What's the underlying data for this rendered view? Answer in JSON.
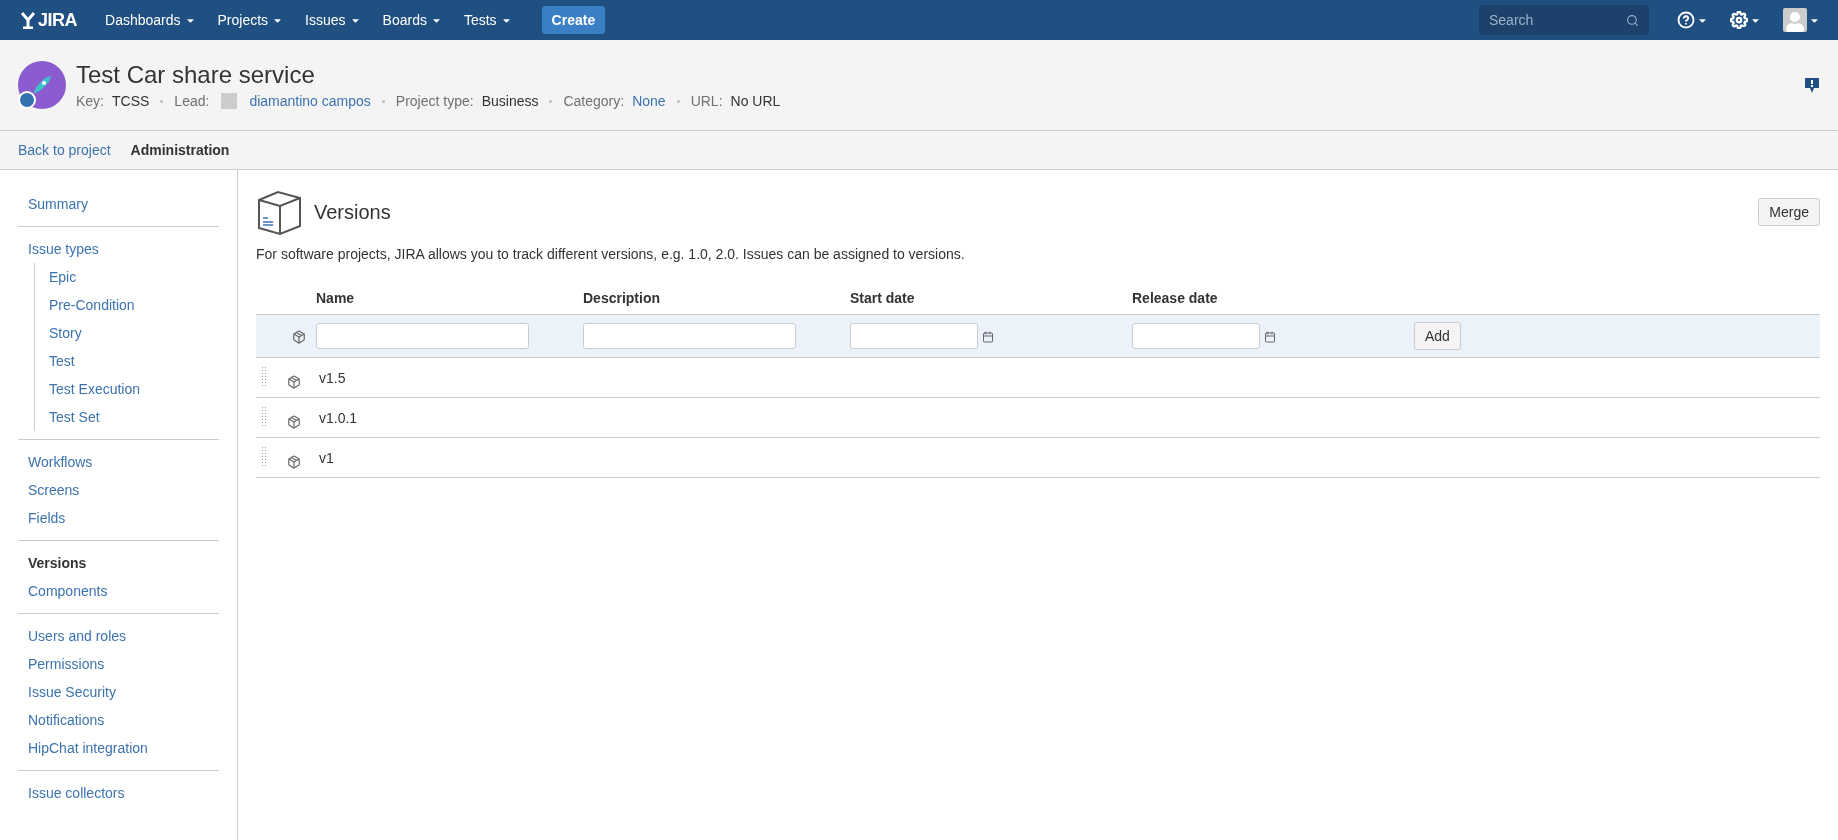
{
  "topnav": {
    "logo": "JIRA",
    "menus": [
      {
        "label": "Dashboards"
      },
      {
        "label": "Projects"
      },
      {
        "label": "Issues"
      },
      {
        "label": "Boards"
      },
      {
        "label": "Tests"
      }
    ],
    "create": "Create",
    "search": {
      "placeholder": "Search"
    }
  },
  "project": {
    "title": "Test Car share service",
    "meta": [
      {
        "kind": "plain",
        "label": "Key:",
        "value": "TCSS"
      },
      {
        "kind": "user",
        "label": "Lead:",
        "value": "diamantino campos"
      },
      {
        "kind": "plain",
        "label": "Project type:",
        "value": "Business"
      },
      {
        "kind": "link",
        "label": "Category:",
        "value": "None"
      },
      {
        "kind": "plain",
        "label": "URL:",
        "value": "No URL"
      }
    ]
  },
  "tabs": [
    {
      "label": "Back to project",
      "selected": false
    },
    {
      "label": "Administration",
      "selected": true
    }
  ],
  "sidebar": {
    "groups": [
      [
        {
          "label": "Summary",
          "selected": false
        }
      ],
      [
        {
          "label": "Issue types",
          "selected": false,
          "children": [
            {
              "label": "Epic",
              "selected": false
            },
            {
              "label": "Pre-Condition",
              "selected": false
            },
            {
              "label": "Story",
              "selected": false
            },
            {
              "label": "Test",
              "selected": false
            },
            {
              "label": "Test Execution",
              "selected": false
            },
            {
              "label": "Test Set",
              "selected": false
            }
          ]
        }
      ],
      [
        {
          "label": "Workflows",
          "selected": false
        },
        {
          "label": "Screens",
          "selected": false
        },
        {
          "label": "Fields",
          "selected": false
        }
      ],
      [
        {
          "label": "Versions",
          "selected": true
        },
        {
          "label": "Components",
          "selected": false
        }
      ],
      [
        {
          "label": "Users and roles",
          "selected": false
        },
        {
          "label": "Permissions",
          "selected": false
        },
        {
          "label": "Issue Security",
          "selected": false
        },
        {
          "label": "Notifications",
          "selected": false
        },
        {
          "label": "HipChat integration",
          "selected": false
        }
      ],
      [
        {
          "label": "Issue collectors",
          "selected": false
        }
      ]
    ]
  },
  "main": {
    "title": "Versions",
    "merge": "Merge",
    "description": "For software projects, JIRA allows you to track different versions, e.g. 1.0, 2.0. Issues can be assigned to versions.",
    "table": {
      "columns": [
        "Name",
        "Description",
        "Start date",
        "Release date"
      ],
      "add": "Add",
      "rows": [
        {
          "name": "v1.5"
        },
        {
          "name": "v1.0.1"
        },
        {
          "name": "v1"
        }
      ]
    }
  }
}
